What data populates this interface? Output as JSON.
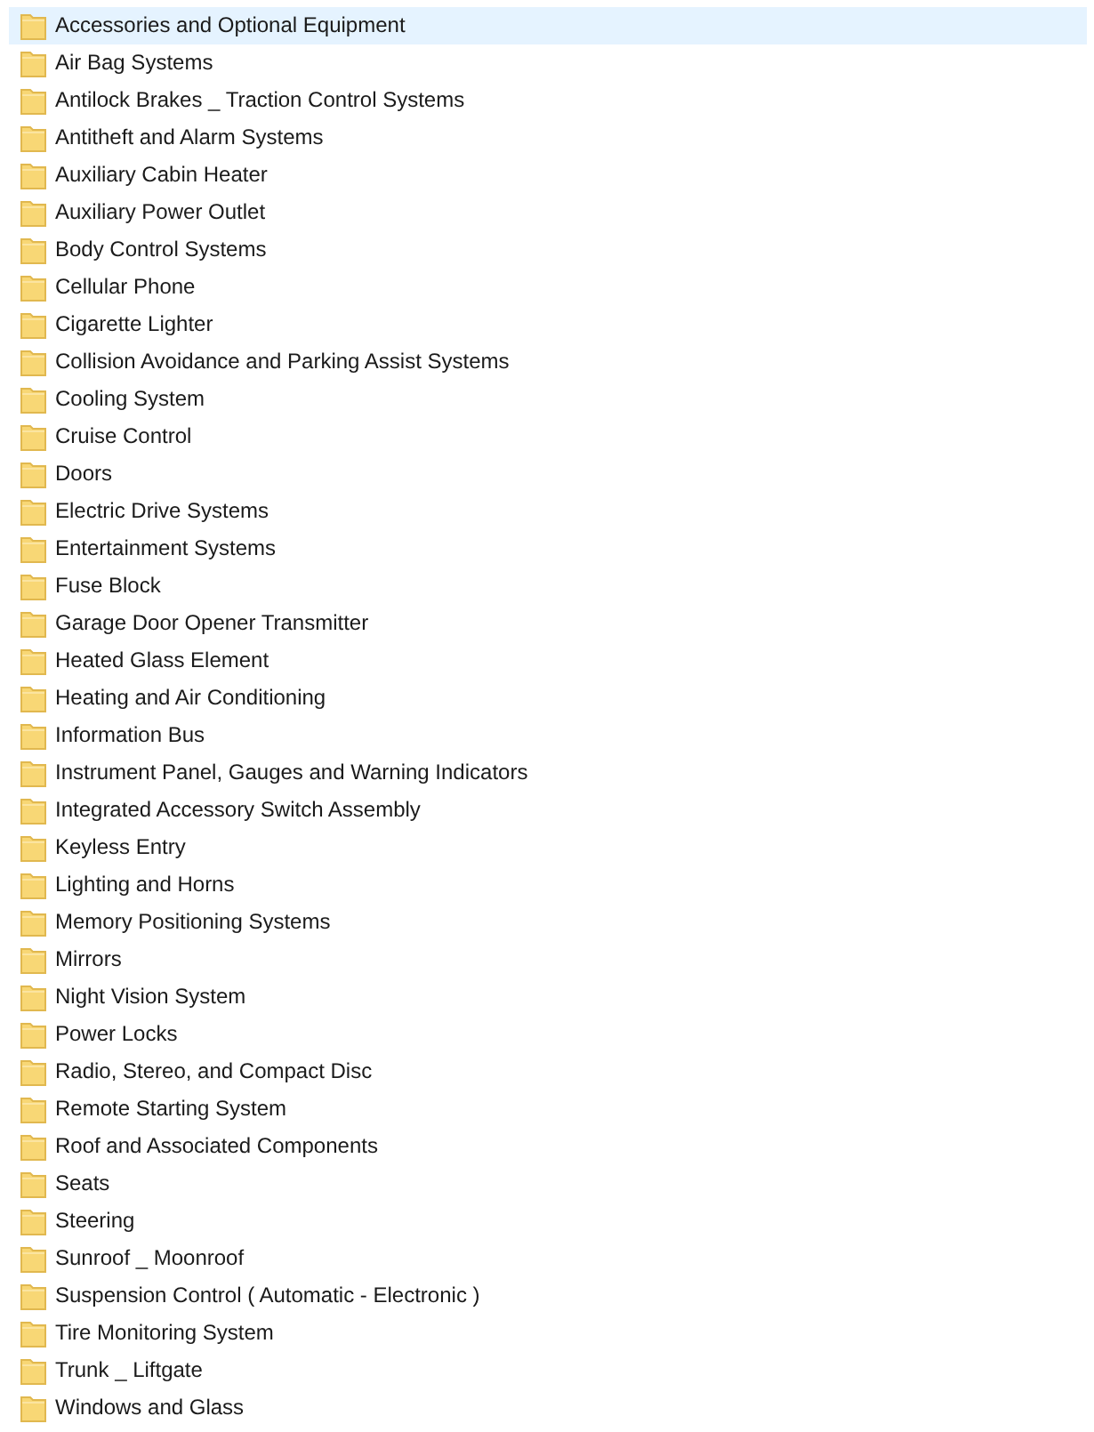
{
  "items": [
    {
      "label": "Accessories and Optional Equipment",
      "selected": true
    },
    {
      "label": "Air Bag Systems",
      "selected": false
    },
    {
      "label": "Antilock Brakes _ Traction Control Systems",
      "selected": false
    },
    {
      "label": "Antitheft and Alarm Systems",
      "selected": false
    },
    {
      "label": "Auxiliary Cabin Heater",
      "selected": false
    },
    {
      "label": "Auxiliary Power Outlet",
      "selected": false
    },
    {
      "label": "Body Control Systems",
      "selected": false
    },
    {
      "label": "Cellular Phone",
      "selected": false
    },
    {
      "label": "Cigarette Lighter",
      "selected": false
    },
    {
      "label": "Collision Avoidance and Parking Assist Systems",
      "selected": false
    },
    {
      "label": "Cooling System",
      "selected": false
    },
    {
      "label": "Cruise Control",
      "selected": false
    },
    {
      "label": "Doors",
      "selected": false
    },
    {
      "label": "Electric Drive Systems",
      "selected": false
    },
    {
      "label": "Entertainment Systems",
      "selected": false
    },
    {
      "label": "Fuse Block",
      "selected": false
    },
    {
      "label": "Garage Door Opener Transmitter",
      "selected": false
    },
    {
      "label": "Heated Glass Element",
      "selected": false
    },
    {
      "label": "Heating and Air Conditioning",
      "selected": false
    },
    {
      "label": "Information Bus",
      "selected": false
    },
    {
      "label": "Instrument Panel, Gauges and Warning Indicators",
      "selected": false
    },
    {
      "label": "Integrated Accessory Switch Assembly",
      "selected": false
    },
    {
      "label": "Keyless Entry",
      "selected": false
    },
    {
      "label": "Lighting and Horns",
      "selected": false
    },
    {
      "label": "Memory Positioning Systems",
      "selected": false
    },
    {
      "label": "Mirrors",
      "selected": false
    },
    {
      "label": "Night Vision System",
      "selected": false
    },
    {
      "label": "Power Locks",
      "selected": false
    },
    {
      "label": "Radio, Stereo, and Compact Disc",
      "selected": false
    },
    {
      "label": "Remote Starting System",
      "selected": false
    },
    {
      "label": "Roof and Associated Components",
      "selected": false
    },
    {
      "label": "Seats",
      "selected": false
    },
    {
      "label": "Steering",
      "selected": false
    },
    {
      "label": "Sunroof _ Moonroof",
      "selected": false
    },
    {
      "label": "Suspension Control ( Automatic - Electronic )",
      "selected": false
    },
    {
      "label": "Tire Monitoring System",
      "selected": false
    },
    {
      "label": "Trunk _ Liftgate",
      "selected": false
    },
    {
      "label": "Windows and Glass",
      "selected": false
    }
  ]
}
